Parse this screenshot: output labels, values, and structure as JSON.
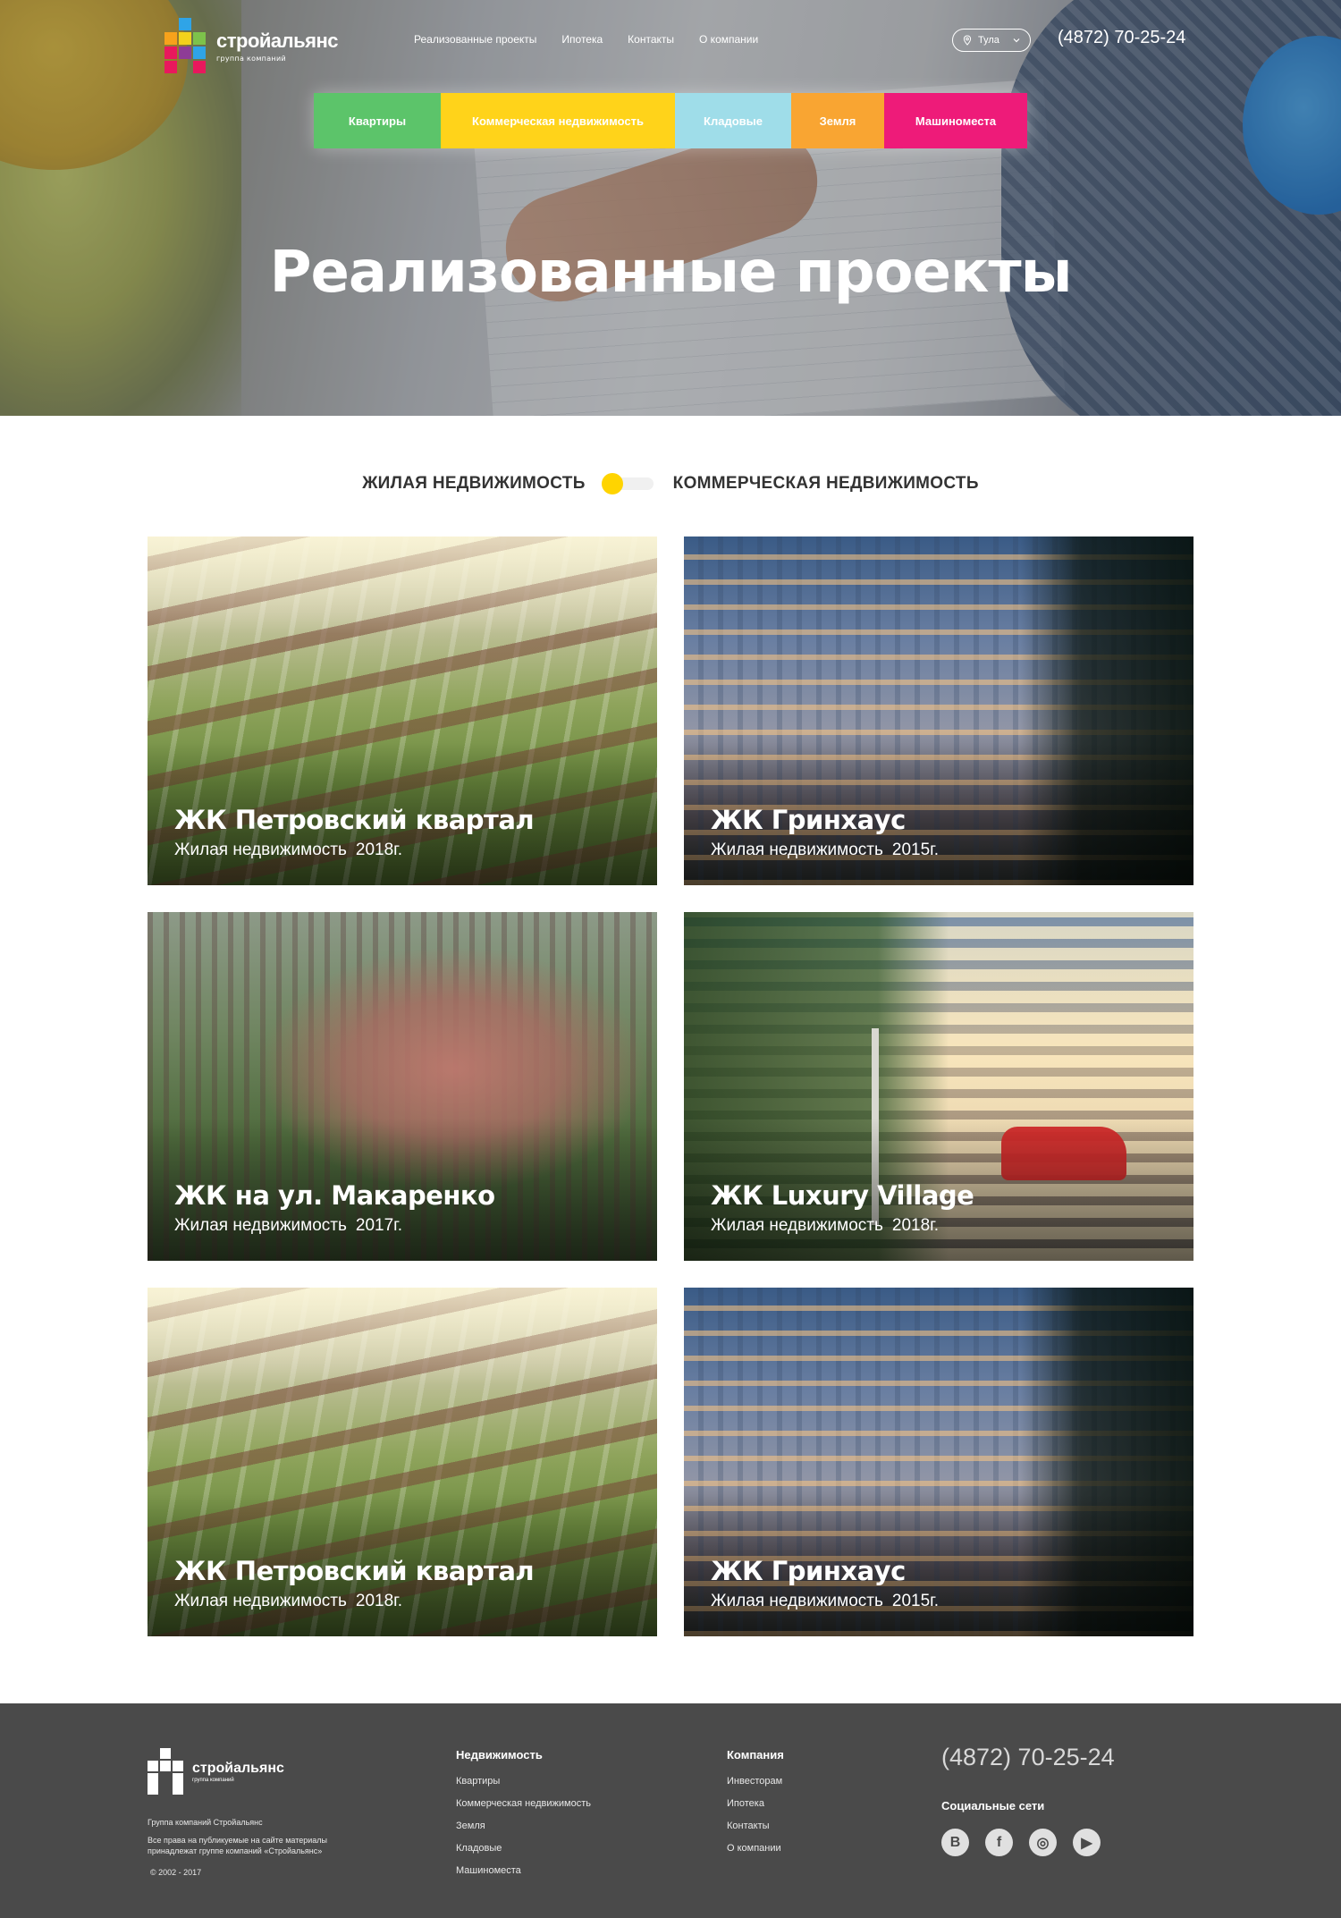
{
  "brand": {
    "name": "стройальянс",
    "subtitle": "группа компаний",
    "logo_colors": [
      "#2fa4e7",
      "#f7a21b",
      "#e8185d",
      "#7dc24b",
      "#8e3c97",
      "#f2d21b"
    ]
  },
  "topnav": {
    "items": [
      "Реализованные проекты",
      "Ипотека",
      "Контакты",
      "О компании"
    ]
  },
  "city": {
    "label": "Тула"
  },
  "phone": "(4872) 70-25-24",
  "categories": [
    {
      "label": "Квартиры",
      "color": "#5cc46a"
    },
    {
      "label": "Коммерческая недвижимость",
      "color": "#ffd31a"
    },
    {
      "label": "Кладовые",
      "color": "#9fdde9"
    },
    {
      "label": "Земля",
      "color": "#f9a532"
    },
    {
      "label": "Машиноместа",
      "color": "#ee1b79"
    }
  ],
  "hero": {
    "title": "Реализованные проекты"
  },
  "filter": {
    "left_label": "ЖИЛАЯ НЕДВИЖИМОСТЬ",
    "right_label": "КОММЕРЧЕСКАЯ НЕДВИЖИМОСТЬ",
    "accent": "#ffd400"
  },
  "projects": [
    {
      "title": "ЖК Петровский квартал",
      "type": "Жилая недвижимость",
      "year": "2018г."
    },
    {
      "title": "ЖК Гринхаус",
      "type": "Жилая недвижимость",
      "year": "2015г."
    },
    {
      "title": "ЖК на ул. Макаренко",
      "type": "Жилая недвижимость",
      "year": "2017г."
    },
    {
      "title": "ЖК Luxury Village",
      "type": "Жилая недвижимость",
      "year": "2018г."
    },
    {
      "title": "ЖК Петровский квартал",
      "type": "Жилая недвижимость",
      "year": "2018г."
    },
    {
      "title": "ЖК Гринхаус",
      "type": "Жилая недвижимость",
      "year": "2015г."
    }
  ],
  "footer": {
    "brand_name": "стройальянс",
    "brand_sub": "группа компаний",
    "group_text": "Группа компаний Стройальянс",
    "rights_text": "Все права на публикуемые на сайте материалы принадлежат группе компаний «Стройальянс»",
    "copyright": "© 2002 - 2017",
    "col1": {
      "heading": "Недвижимость",
      "links": [
        "Квартиры",
        "Коммерческая недвижимость",
        "Земля",
        "Кладовые",
        "Машиноместа"
      ]
    },
    "col2": {
      "heading": "Компания",
      "links": [
        "Инвесторам",
        "Ипотека",
        "Контакты",
        "О компании"
      ]
    },
    "phone": "(4872) 70-25-24",
    "social_heading": "Социальные сети",
    "socials": [
      {
        "name": "vk-icon",
        "glyph": "В"
      },
      {
        "name": "facebook-icon",
        "glyph": "f"
      },
      {
        "name": "instagram-icon",
        "glyph": "◎"
      },
      {
        "name": "youtube-icon",
        "glyph": "▶"
      }
    ]
  }
}
